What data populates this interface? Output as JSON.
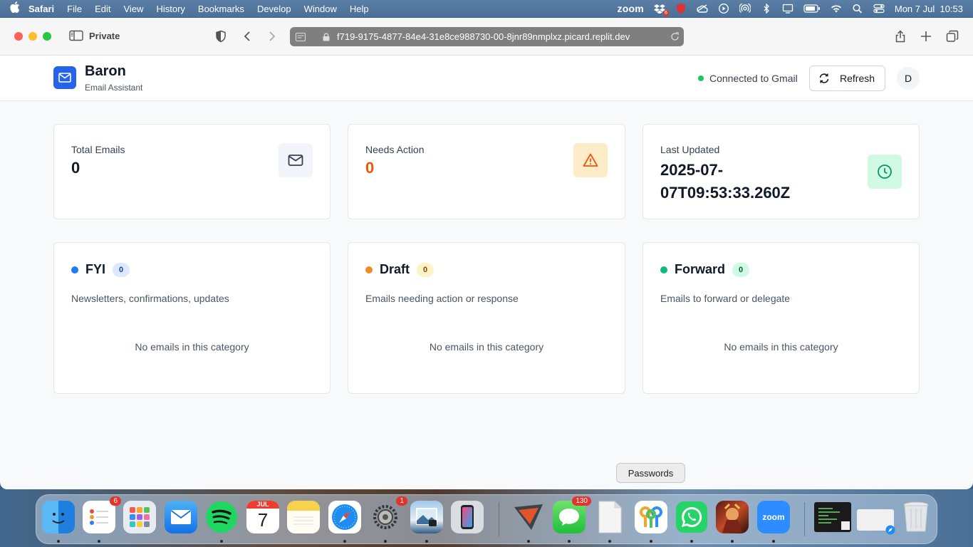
{
  "menubar": {
    "app": "Safari",
    "items": [
      "File",
      "Edit",
      "View",
      "History",
      "Bookmarks",
      "Develop",
      "Window",
      "Help"
    ],
    "zoom_label": "zoom",
    "badge": "6",
    "datetime": "Mon 7 Jul  10:53"
  },
  "browser": {
    "mode_label": "Private",
    "url": "f719-9175-4877-84e4-31e8ce988730-00-8jnr89nmplxz.picard.replit.dev"
  },
  "app": {
    "title": "Baron",
    "subtitle": "Email Assistant",
    "connection_status": "Connected to Gmail",
    "refresh_label": "Refresh",
    "avatar_initial": "D"
  },
  "stats": [
    {
      "label": "Total Emails",
      "value": "0",
      "icon": "mail-icon",
      "icon_bg": "#f1f5f9",
      "icon_color": "#374151"
    },
    {
      "label": "Needs Action",
      "value": "0",
      "icon": "warning-icon",
      "icon_bg": "#fdecc8",
      "icon_color": "#ea580c"
    },
    {
      "label": "Last Updated",
      "value": "2025-07-07T09:53:33.260Z",
      "icon": "clock-icon",
      "icon_bg": "#d1fae5",
      "icon_color": "#059669"
    }
  ],
  "categories": [
    {
      "title": "FYI",
      "count": "0",
      "description": "Newsletters, confirmations, updates",
      "empty_text": "No emails in this category",
      "color": "#1d7df2",
      "badge_bg": "#dbeafe",
      "badge_color": "#1e40af"
    },
    {
      "title": "Draft",
      "count": "0",
      "description": "Emails needing action or response",
      "empty_text": "No emails in this category",
      "color": "#f28a1d",
      "badge_bg": "#fef3c7",
      "badge_color": "#92400e"
    },
    {
      "title": "Forward",
      "count": "0",
      "description": "Emails to forward or delegate",
      "empty_text": "No emails in this category",
      "color": "#10b981",
      "badge_bg": "#d1fae5",
      "badge_color": "#065f46"
    }
  ],
  "dock": {
    "tooltip": "Passwords",
    "reminders_badge": "6",
    "calendar_month": "JUL",
    "calendar_day": "7",
    "settings_badge": "1",
    "messages_badge": "130",
    "zoom_label": "zoom"
  }
}
